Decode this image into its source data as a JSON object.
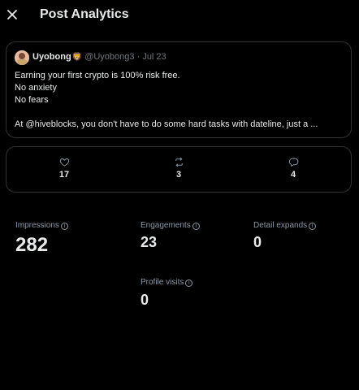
{
  "header": {
    "title": "Post Analytics",
    "close_icon": "close-icon"
  },
  "post": {
    "display_name": "Uyobong",
    "name_emoji": "🦁",
    "handle": "@Uyobong3",
    "separator": "·",
    "date": "Jul 23",
    "lines": [
      "Earning your first crypto is 100% risk free.",
      "No anxiety",
      "No fears",
      "",
      "At @hiveblocks, you don't have to do some hard tasks with dateline, just a ..."
    ]
  },
  "engagement": {
    "likes": {
      "icon": "heart-icon",
      "count": "17"
    },
    "reposts": {
      "icon": "repost-icon",
      "count": "3"
    },
    "replies": {
      "icon": "reply-icon",
      "count": "4"
    }
  },
  "metrics": {
    "impressions": {
      "label": "Impressions",
      "value": "282"
    },
    "engagements": {
      "label": "Engagements",
      "value": "23"
    },
    "detail_expands": {
      "label": "Detail expands",
      "value": "0"
    },
    "profile_visits": {
      "label": "Profile visits",
      "value": "0"
    },
    "info_icon": "i"
  },
  "colors": {
    "background": "#000000",
    "border": "#2f3336",
    "text": "#e7e9ea",
    "muted": "#71767b"
  }
}
